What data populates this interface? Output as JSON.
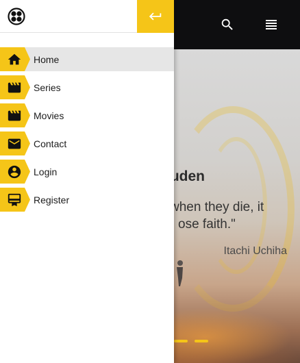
{
  "hero": {
    "title_visible": "ouden",
    "quote_line1": "when they die, it",
    "quote_line2": "ose faith.\"",
    "author": "Itachi Uchiha"
  },
  "topbar": {
    "search_icon": "search-icon",
    "menu_icon": "list-menu-icon"
  },
  "drawer": {
    "logo_icon": "fan-logo-icon",
    "close_icon": "return-arrow-icon",
    "accent_color": "#f5c518",
    "items": [
      {
        "label": "Home",
        "icon": "home-icon",
        "active": true
      },
      {
        "label": "Series",
        "icon": "movie-clapper-icon",
        "active": false
      },
      {
        "label": "Movies",
        "icon": "movie-clapper-icon",
        "active": false
      },
      {
        "label": "Contact",
        "icon": "mail-icon",
        "active": false
      },
      {
        "label": "Login",
        "icon": "account-circle-icon",
        "active": false
      },
      {
        "label": "Register",
        "icon": "card-membership-icon",
        "active": false
      }
    ]
  },
  "carousel": {
    "visible_indicators": 2
  }
}
